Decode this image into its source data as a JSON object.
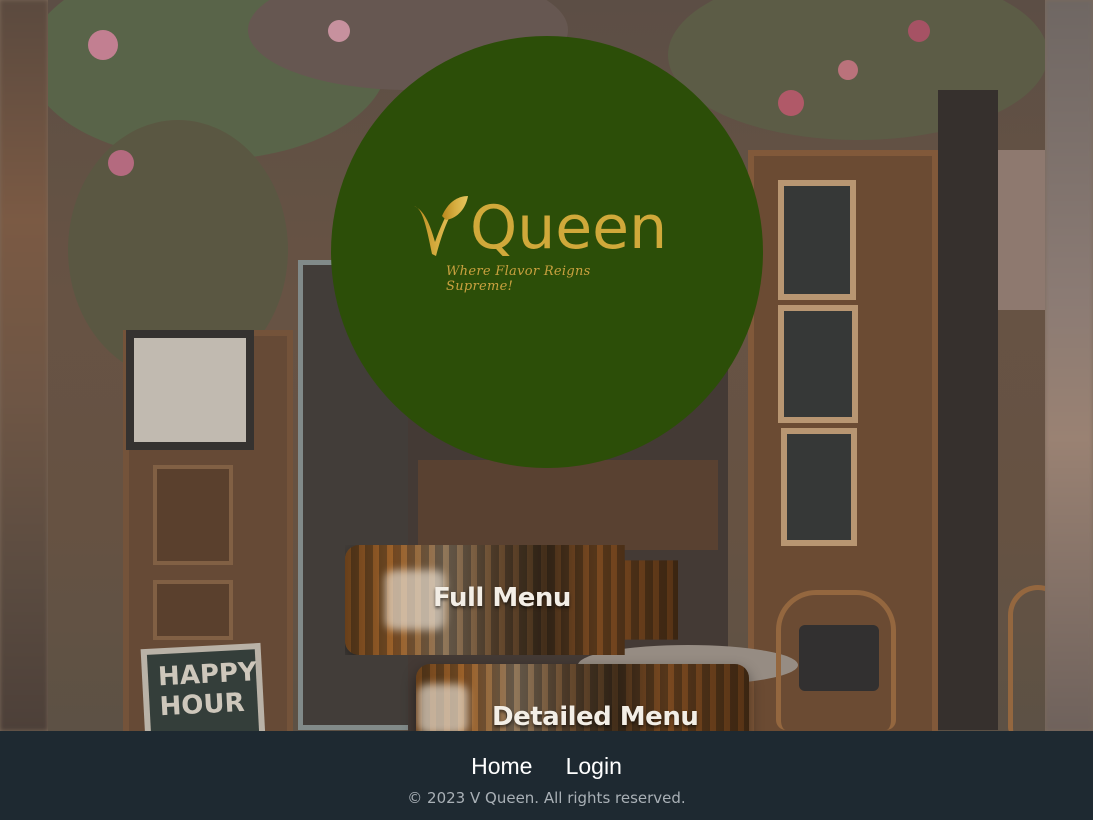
{
  "brand": {
    "name": "Queen",
    "logo_letter": "V",
    "tagline": "Where Flavor Reigns Supreme!",
    "circle_color": "#2c4e08",
    "gold_color": "#d0a93a"
  },
  "background": {
    "sign_text_line1": "HAPPY",
    "sign_text_line2": "HOUR"
  },
  "menu_buttons": [
    {
      "label": "Full Menu"
    },
    {
      "label": "Detailed Menu"
    }
  ],
  "footer": {
    "nav": [
      {
        "label": "Home"
      },
      {
        "label": "Login"
      }
    ],
    "copyright": "© 2023 V Queen. All rights reserved.",
    "background_color": "#1e2931"
  }
}
